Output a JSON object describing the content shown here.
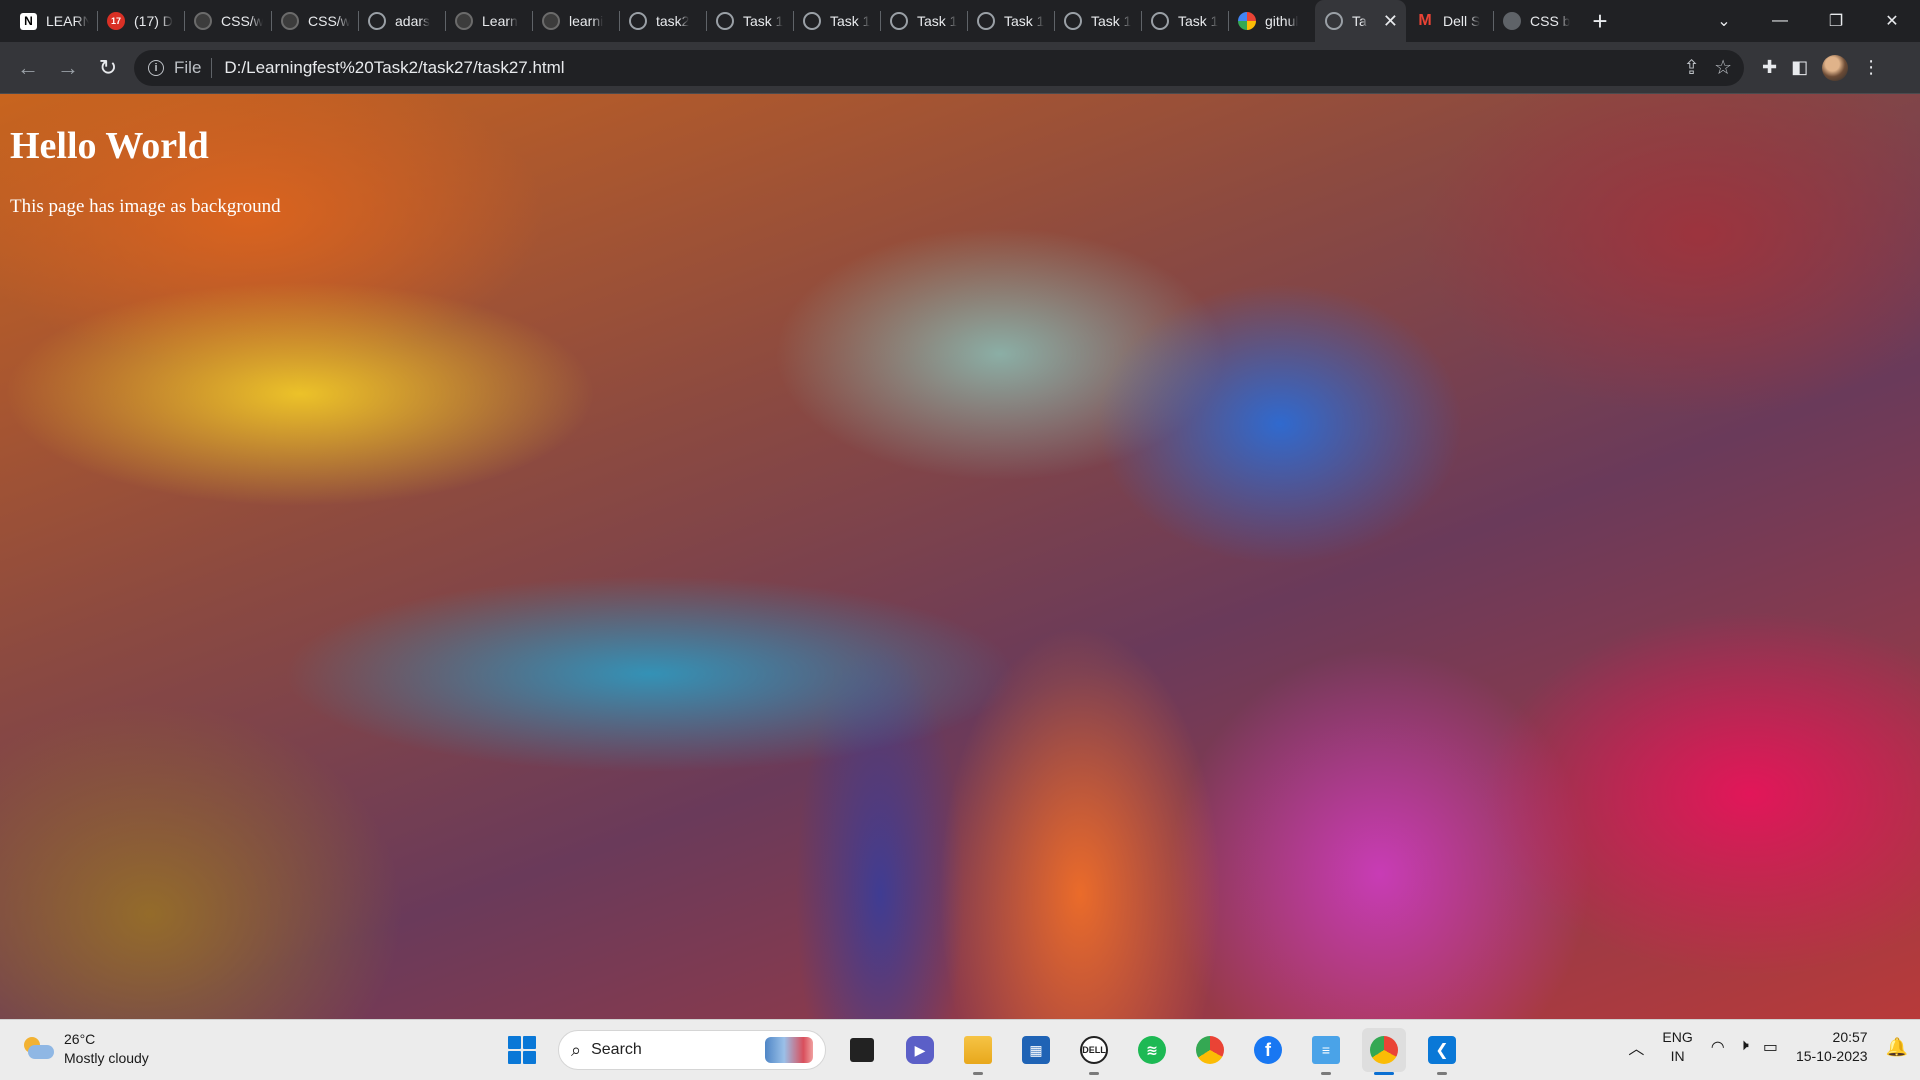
{
  "browser": {
    "tabs": [
      {
        "title": "LEARN",
        "favicon": "notion-icon"
      },
      {
        "title": "(17) D",
        "favicon": "red-badge-icon"
      },
      {
        "title": "CSS/w",
        "favicon": "github-icon"
      },
      {
        "title": "CSS/w",
        "favicon": "github-icon"
      },
      {
        "title": "adars",
        "favicon": "globe-icon"
      },
      {
        "title": "Learn",
        "favicon": "github-icon"
      },
      {
        "title": "learni",
        "favicon": "github-icon"
      },
      {
        "title": "task2",
        "favicon": "globe-icon"
      },
      {
        "title": "Task 1",
        "favicon": "globe-icon"
      },
      {
        "title": "Task 1",
        "favicon": "globe-icon"
      },
      {
        "title": "Task 1",
        "favicon": "globe-icon"
      },
      {
        "title": "Task 1",
        "favicon": "globe-icon"
      },
      {
        "title": "Task 1",
        "favicon": "globe-icon"
      },
      {
        "title": "Task 1",
        "favicon": "globe-icon"
      },
      {
        "title": "githul",
        "favicon": "google-icon"
      },
      {
        "title": "Ta",
        "favicon": "globe-icon",
        "active": true
      },
      {
        "title": "Dell S",
        "favicon": "gmail-icon"
      },
      {
        "title": "CSS b",
        "favicon": "loading-icon"
      }
    ],
    "new_tab_glyph": "+",
    "address": {
      "scheme_chip": "File",
      "url": "D:/Learningfest%20Task2/task27/task27.html"
    }
  },
  "page": {
    "heading": "Hello World",
    "text": "This page has image as background"
  },
  "taskbar": {
    "weather": {
      "temp": "26°C",
      "condition": "Mostly cloudy"
    },
    "search_placeholder": "Search",
    "tray": {
      "lang_line1": "ENG",
      "lang_line2": "IN",
      "time": "20:57",
      "date": "15-10-2023"
    }
  },
  "colors": {
    "chrome_dark": "#202124",
    "toolbar": "#35363a",
    "taskbar": "#ececec",
    "accent_blue": "#0a78d7"
  }
}
